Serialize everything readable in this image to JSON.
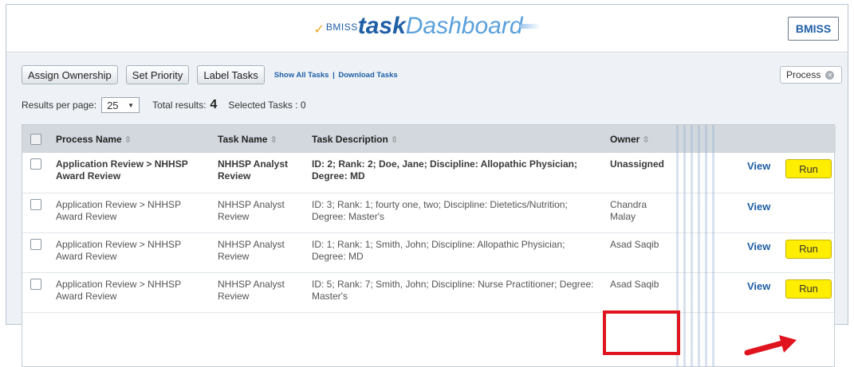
{
  "header": {
    "brand_check": "✓",
    "brand_bmiss": "BMISS",
    "brand_task": "task",
    "brand_dashboard": "Dashboard",
    "bmiss_button": "BMISS"
  },
  "toolbar": {
    "assign_ownership": "Assign Ownership",
    "set_priority": "Set Priority",
    "label_tasks": "Label Tasks",
    "show_all_tasks": "Show All Tasks",
    "separator": "|",
    "download_tasks": "Download Tasks",
    "filter_chip": "Process"
  },
  "results": {
    "per_page_label": "Results per page:",
    "per_page_value": "25",
    "total_label": "Total results:",
    "total_value": "4",
    "selected_label": "Selected Tasks : 0"
  },
  "table": {
    "columns": [
      "Process Name",
      "Task Name",
      "Task Description",
      "Owner"
    ],
    "sort_icon": "⇳",
    "view_label": "View",
    "run_label": "Run",
    "rows": [
      {
        "process": "Application Review > NHHSP Award Review",
        "task": "NHHSP Analyst Review",
        "description": "ID: 2; Rank: 2; Doe, Jane; Discipline: Allopathic Physician; Degree: MD",
        "owner": "Unassigned"
      },
      {
        "process": "Application Review > NHHSP Award Review",
        "task": "NHHSP Analyst Review",
        "description": "ID: 3; Rank: 1; fourty one, two; Discipline: Dietetics/Nutrition; Degree: Master's",
        "owner": "Chandra Malay"
      },
      {
        "process": "Application Review > NHHSP Award Review",
        "task": "NHHSP Analyst Review",
        "description": "ID: 1; Rank: 1; Smith, John; Discipline: Allopathic Physician; Degree: MD",
        "owner": "Asad Saqib"
      },
      {
        "process": "Application Review > NHHSP Award Review",
        "task": "NHHSP Analyst Review",
        "description": "ID: 5; Rank: 7; Smith, John; Discipline: Nurse Practitioner; Degree: Master's",
        "owner": "Asad Saqib"
      }
    ]
  },
  "colors": {
    "brand_blue": "#1f5fa6",
    "run_yellow": "#ffee00",
    "annotation_red": "#e0141e"
  }
}
